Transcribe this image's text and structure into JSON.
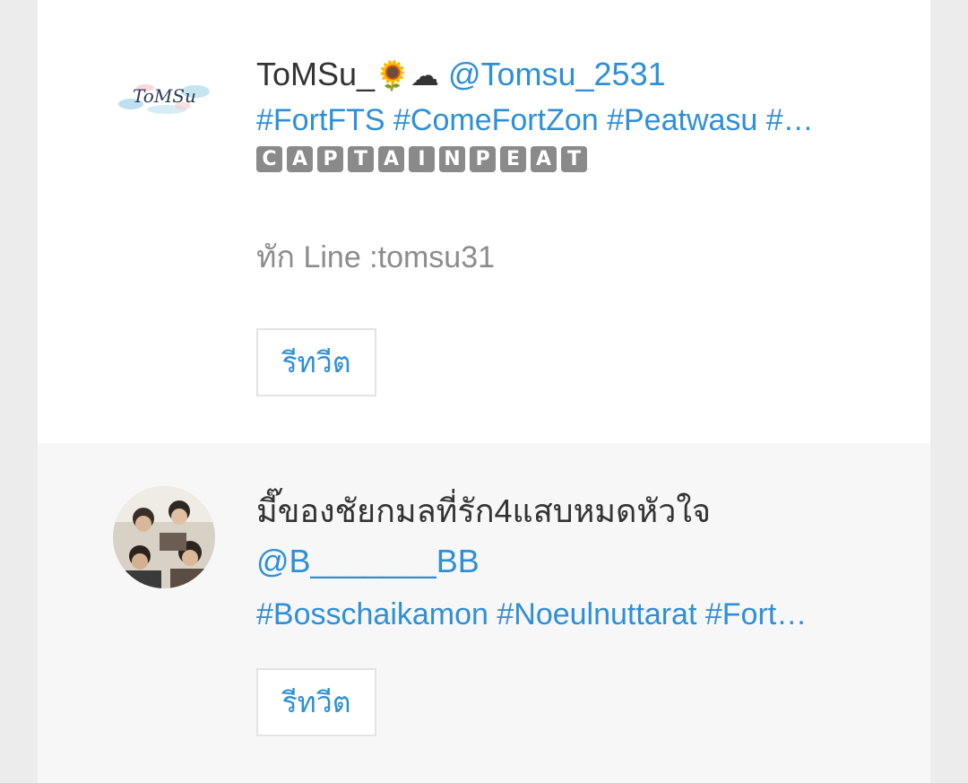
{
  "tweets": [
    {
      "display_name": "ToMSu_",
      "name_emojis": "🌻☁",
      "handle": "@Tomsu_2531",
      "hashtags": "#FortFTS #ComeFortZon #Peatwasu #…",
      "captain_letters": [
        "C",
        "A",
        "P",
        "T",
        "A",
        "I",
        "N",
        "P",
        "E",
        "A",
        "T"
      ],
      "note": "ทัก Line :tomsu31",
      "avatar_text": "ToMSu",
      "retweet_label": "รีทวีต"
    },
    {
      "display_name": "มี๊ของชัยกมลที่รัก4แสบหมดหัวใจ",
      "handle": "@B_______BB",
      "hashtags": "#Bosschaikamon #Noeulnuttarat #Fort…",
      "retweet_label": "รีทวีต"
    }
  ],
  "colors": {
    "link": "#2e8fd8",
    "text": "#333333",
    "muted": "#8c8c8c",
    "badge": "#8a8a8a"
  }
}
